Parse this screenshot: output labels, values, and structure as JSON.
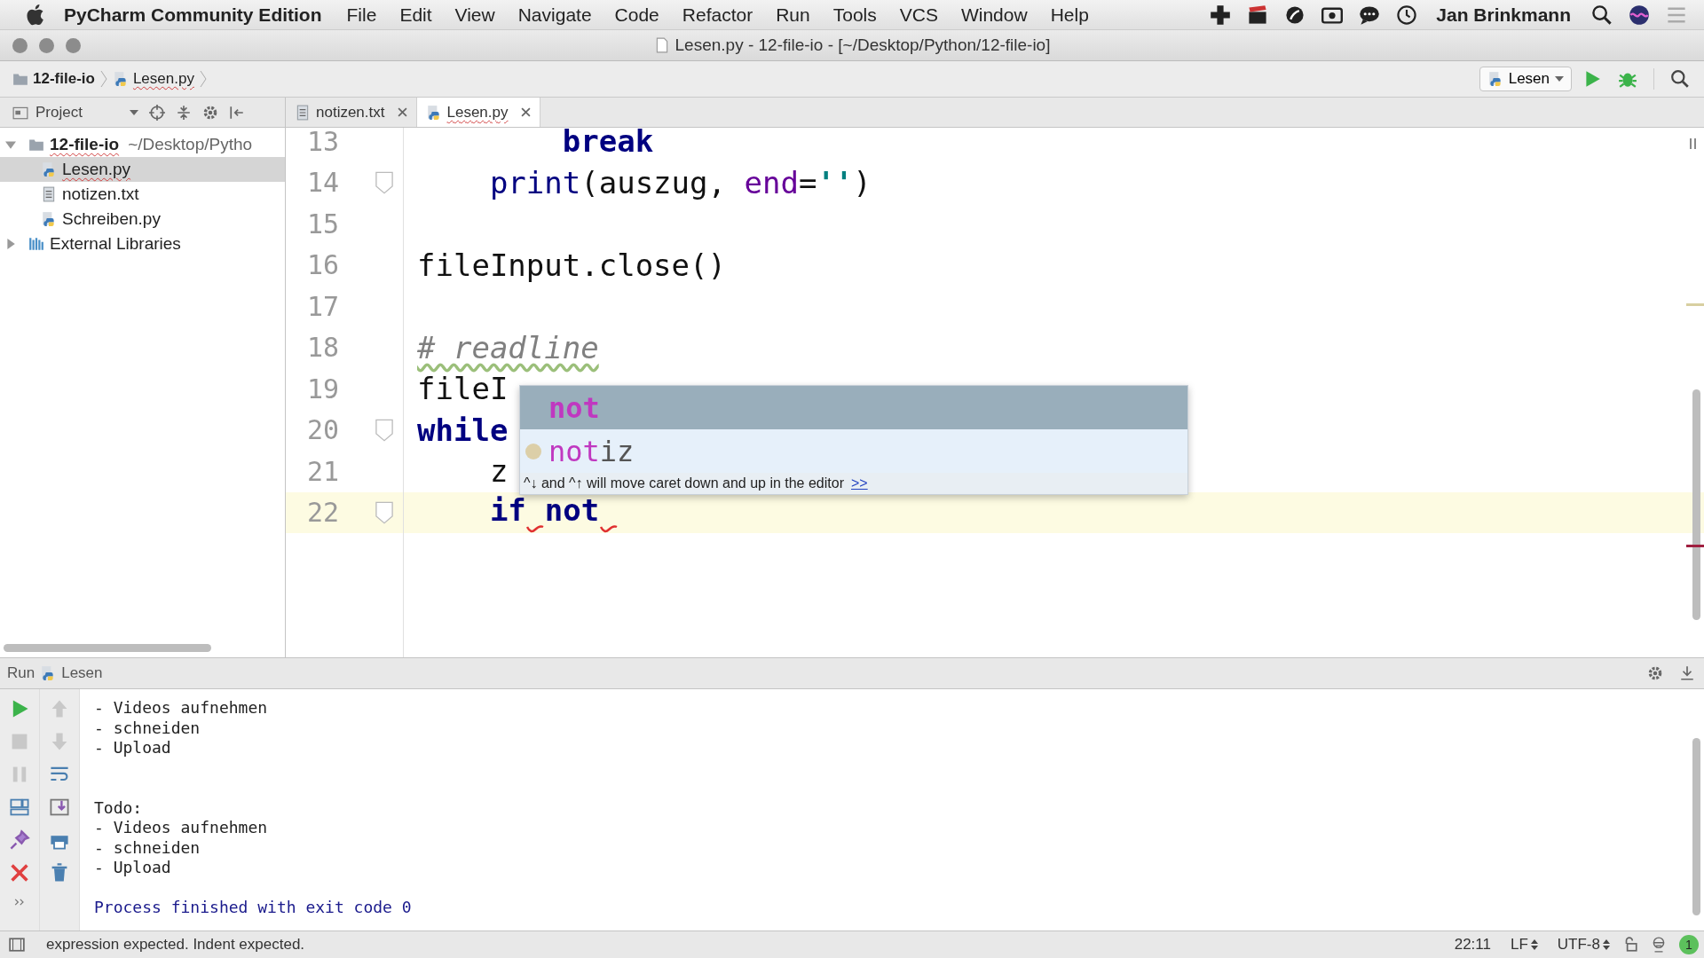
{
  "menu_bar": {
    "app_name": "PyCharm Community Edition",
    "menus": [
      "File",
      "Edit",
      "View",
      "Navigate",
      "Code",
      "Refactor",
      "Run",
      "Tools",
      "VCS",
      "Window",
      "Help"
    ],
    "user": "Jan Brinkmann"
  },
  "window": {
    "title": "Lesen.py - 12-file-io - [~/Desktop/Python/12-file-io]"
  },
  "breadcrumbs": [
    {
      "label": "12-file-io",
      "kind": "folder"
    },
    {
      "label": "Lesen.py",
      "kind": "python"
    }
  ],
  "run_config": {
    "label": "Lesen"
  },
  "project_panel": {
    "label": "Project"
  },
  "tabs": [
    {
      "label": "notizen.txt",
      "kind": "text",
      "selected": false
    },
    {
      "label": "Lesen.py",
      "kind": "python",
      "selected": true
    }
  ],
  "tree": [
    {
      "label": "12-file-io",
      "path": "~/Desktop/Pytho",
      "kind": "folder",
      "expanded": true,
      "selected": false,
      "children": [
        {
          "label": "Lesen.py",
          "kind": "python",
          "selected": true
        },
        {
          "label": "notizen.txt",
          "kind": "text",
          "selected": false
        },
        {
          "label": "Schreiben.py",
          "kind": "python",
          "selected": false
        }
      ]
    },
    {
      "label": "External Libraries",
      "kind": "library",
      "expanded": false,
      "selected": false
    }
  ],
  "editor": {
    "lines": [
      {
        "number": "13",
        "fold": false,
        "current": false,
        "tokens": [
          {
            "kind": "keyword",
            "text": "        break",
            "error_after": false
          }
        ]
      },
      {
        "number": "14",
        "fold": true,
        "current": false,
        "tokens": [
          {
            "kind": "builtin",
            "text": "    print",
            "error_after": false
          },
          {
            "kind": "plain",
            "text": "(auszug, ",
            "error_after": false
          },
          {
            "kind": "param",
            "text": "end",
            "error_after": false
          },
          {
            "kind": "plain",
            "text": "=",
            "error_after": false
          },
          {
            "kind": "string",
            "text": "''",
            "error_after": false
          },
          {
            "kind": "plain",
            "text": ")",
            "error_after": false
          }
        ]
      },
      {
        "number": "15",
        "fold": false,
        "current": false
      },
      {
        "number": "16",
        "fold": false,
        "current": false,
        "tokens": [
          {
            "kind": "plain",
            "text": "fileInput.close()",
            "error_after": false
          }
        ]
      },
      {
        "number": "17",
        "fold": false,
        "current": false
      },
      {
        "number": "18",
        "fold": false,
        "current": false,
        "tokens": [
          {
            "kind": "comment",
            "text": "# readline",
            "error_after": false
          }
        ]
      },
      {
        "number": "19",
        "fold": false,
        "current": false,
        "tokens": [
          {
            "kind": "plain",
            "text": "fileI",
            "error_after": false
          }
        ]
      },
      {
        "number": "20",
        "fold": true,
        "current": false,
        "tokens": [
          {
            "kind": "keyword",
            "text": "while",
            "error_after": false
          }
        ]
      },
      {
        "number": "21",
        "fold": false,
        "current": false,
        "tokens": [
          {
            "kind": "plain",
            "text": "    z",
            "error_after": false
          }
        ]
      },
      {
        "number": "22",
        "fold": true,
        "current": true,
        "tokens": [
          {
            "kind": "keyword",
            "text": "    if",
            "error_after": true
          },
          {
            "kind": "keyword",
            "text": "not",
            "error_after": true
          }
        ]
      }
    ]
  },
  "completion": {
    "items": [
      {
        "kind": "keyword",
        "match": "not",
        "selected": true
      },
      {
        "kind": "variable",
        "match": "not",
        "rest": "iz",
        "selected": false
      }
    ],
    "hint": "^↓ and ^↑ will move caret down and up in the editor",
    "hint_link": ">>"
  },
  "run_panel": {
    "label": "Run",
    "config": "Lesen",
    "console": [
      {
        "kind": "output",
        "text": "- Videos aufnehmen"
      },
      {
        "kind": "output",
        "text": "- schneiden"
      },
      {
        "kind": "output",
        "text": "- Upload"
      },
      {
        "kind": "blank"
      },
      {
        "kind": "blank"
      },
      {
        "kind": "output",
        "text": "Todo:"
      },
      {
        "kind": "output",
        "text": "- Videos aufnehmen"
      },
      {
        "kind": "output",
        "text": "- schneiden"
      },
      {
        "kind": "output",
        "text": "- Upload"
      },
      {
        "kind": "blank"
      },
      {
        "kind": "system",
        "text": "Process finished with exit code 0"
      }
    ]
  },
  "status_bar": {
    "message": "expression expected. Indent expected.",
    "position": "22:11",
    "line_separator": "LF",
    "encoding": "UTF-8",
    "notifications": "1"
  }
}
